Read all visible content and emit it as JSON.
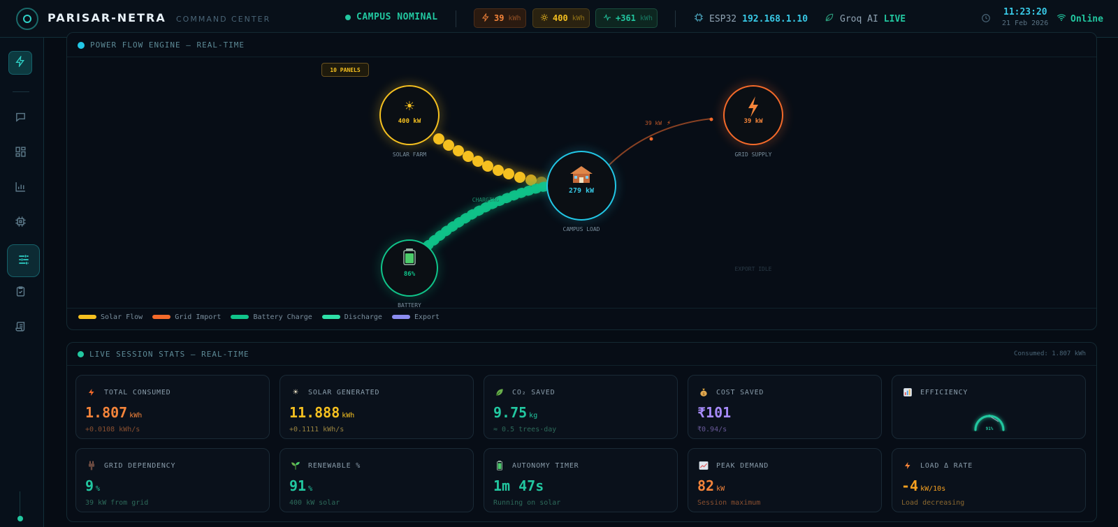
{
  "brand": {
    "name": "PARISAR-NETRA",
    "subtitle": "COMMAND CENTER"
  },
  "status": {
    "label": "CAMPUS NOMINAL",
    "color": "#22c7a0"
  },
  "pills": [
    {
      "icon": "bolt-icon",
      "value": "39",
      "unit": "kWh",
      "color": "#f4843a"
    },
    {
      "icon": "sun-icon",
      "value": "400",
      "unit": "kWh",
      "color": "#f5c020"
    },
    {
      "icon": "pulse-icon",
      "value": "+361",
      "unit": "kWh",
      "color": "#22c7a0"
    }
  ],
  "device": {
    "label": "ESP32",
    "ip": "192.168.1.10"
  },
  "ai": {
    "label": "Groq AI",
    "status": "LIVE"
  },
  "clock": {
    "time": "11:23:20",
    "date": "21 Feb 2026"
  },
  "connection": {
    "label": "Online"
  },
  "sidebar": {
    "items": [
      {
        "name": "sidebar-item-power",
        "icon": "bolt-icon"
      },
      {
        "name": "sidebar-item-chat",
        "icon": "chat-icon"
      },
      {
        "name": "sidebar-item-dashboard",
        "icon": "grid-icon"
      },
      {
        "name": "sidebar-item-analytics",
        "icon": "bar-chart-icon"
      },
      {
        "name": "sidebar-item-hardware",
        "icon": "chip-icon"
      },
      {
        "name": "sidebar-item-controls",
        "icon": "sliders-icon"
      },
      {
        "name": "sidebar-item-tasks",
        "icon": "clipboard-check-icon"
      },
      {
        "name": "sidebar-item-logs",
        "icon": "scroll-icon"
      }
    ]
  },
  "flow": {
    "title": "POWER FLOW ENGINE — REAL-TIME",
    "panels_badge": "10 PANELS",
    "solar": {
      "value": "400 kW",
      "label": "SOLAR FARM"
    },
    "grid": {
      "value": "39 kW",
      "label": "GRID SUPPLY"
    },
    "campus": {
      "value": "279 kW",
      "label": "CAMPUS LOAD"
    },
    "battery": {
      "value": "86%",
      "label": "BATTERY"
    },
    "grid_line_label": "39 kW",
    "charging_label": "CHARGING",
    "export_label": "EXPORT IDLE",
    "legend": [
      {
        "label": "Solar Flow",
        "color": "#f5c020"
      },
      {
        "label": "Grid Import",
        "color": "#f46a2a"
      },
      {
        "label": "Battery Charge",
        "color": "#10c48a"
      },
      {
        "label": "Discharge",
        "color": "#2ee0a8"
      },
      {
        "label": "Export",
        "color": "#8b8cf0"
      }
    ]
  },
  "stats": {
    "title": "LIVE SESSION STATS — REAL-TIME",
    "consumed_note": "Consumed: 1.807 kWh",
    "cards": [
      {
        "label": "TOTAL CONSUMED",
        "icon": "bolt-icon",
        "value": "1.807",
        "unit": "kWh",
        "sub": "+0.0108 kWh/s",
        "color": "#f4843a",
        "subcolor": "#8a5030"
      },
      {
        "label": "SOLAR GENERATED",
        "icon": "sun-icon",
        "value": "11.888",
        "unit": "kWh",
        "sub": "+0.1111 kWh/s",
        "color": "#f5c020",
        "subcolor": "#9a8440"
      },
      {
        "label": "CO₂ SAVED",
        "icon": "leaf-icon",
        "value": "9.75",
        "unit": "kg",
        "sub": "≈ 0.5 trees·day",
        "color": "#22c7a0",
        "subcolor": "#2d6a5a"
      },
      {
        "label": "COST SAVED",
        "icon": "money-bag-icon",
        "value": "₹101",
        "unit": "",
        "sub": "₹0.94/s",
        "color": "#a78bfa",
        "subcolor": "#6a5a9a"
      },
      {
        "label": "EFFICIENCY",
        "icon": "chart-icon",
        "value": "",
        "unit": "",
        "sub": "",
        "gauge": "91%",
        "color": "#22c7a0"
      },
      {
        "label": "GRID DEPENDENCY",
        "icon": "plug-icon",
        "value": "9",
        "unit": "%",
        "sub": "39 kW from grid",
        "color": "#22c7a0",
        "subcolor": "#2d6a5a"
      },
      {
        "label": "RENEWABLE %",
        "icon": "seedling-icon",
        "value": "91",
        "unit": "%",
        "sub": "400 kW solar",
        "color": "#22c7a0",
        "subcolor": "#2d6a5a"
      },
      {
        "label": "AUTONOMY TIMER",
        "icon": "battery-icon",
        "value": "1m 47s",
        "unit": "",
        "sub": "Running on solar",
        "color": "#22c7a0",
        "subcolor": "#2d6a5a"
      },
      {
        "label": "PEAK DEMAND",
        "icon": "trend-icon",
        "value": "82",
        "unit": "kW",
        "sub": "Session maximum",
        "color": "#f4843a",
        "subcolor": "#8a5030"
      },
      {
        "label": "LOAD Δ RATE",
        "icon": "bolt-icon",
        "value": "-4",
        "unit": "kW/10s",
        "sub": "Load decreasing",
        "color": "#f5a020",
        "subcolor": "#8a6830"
      }
    ]
  }
}
